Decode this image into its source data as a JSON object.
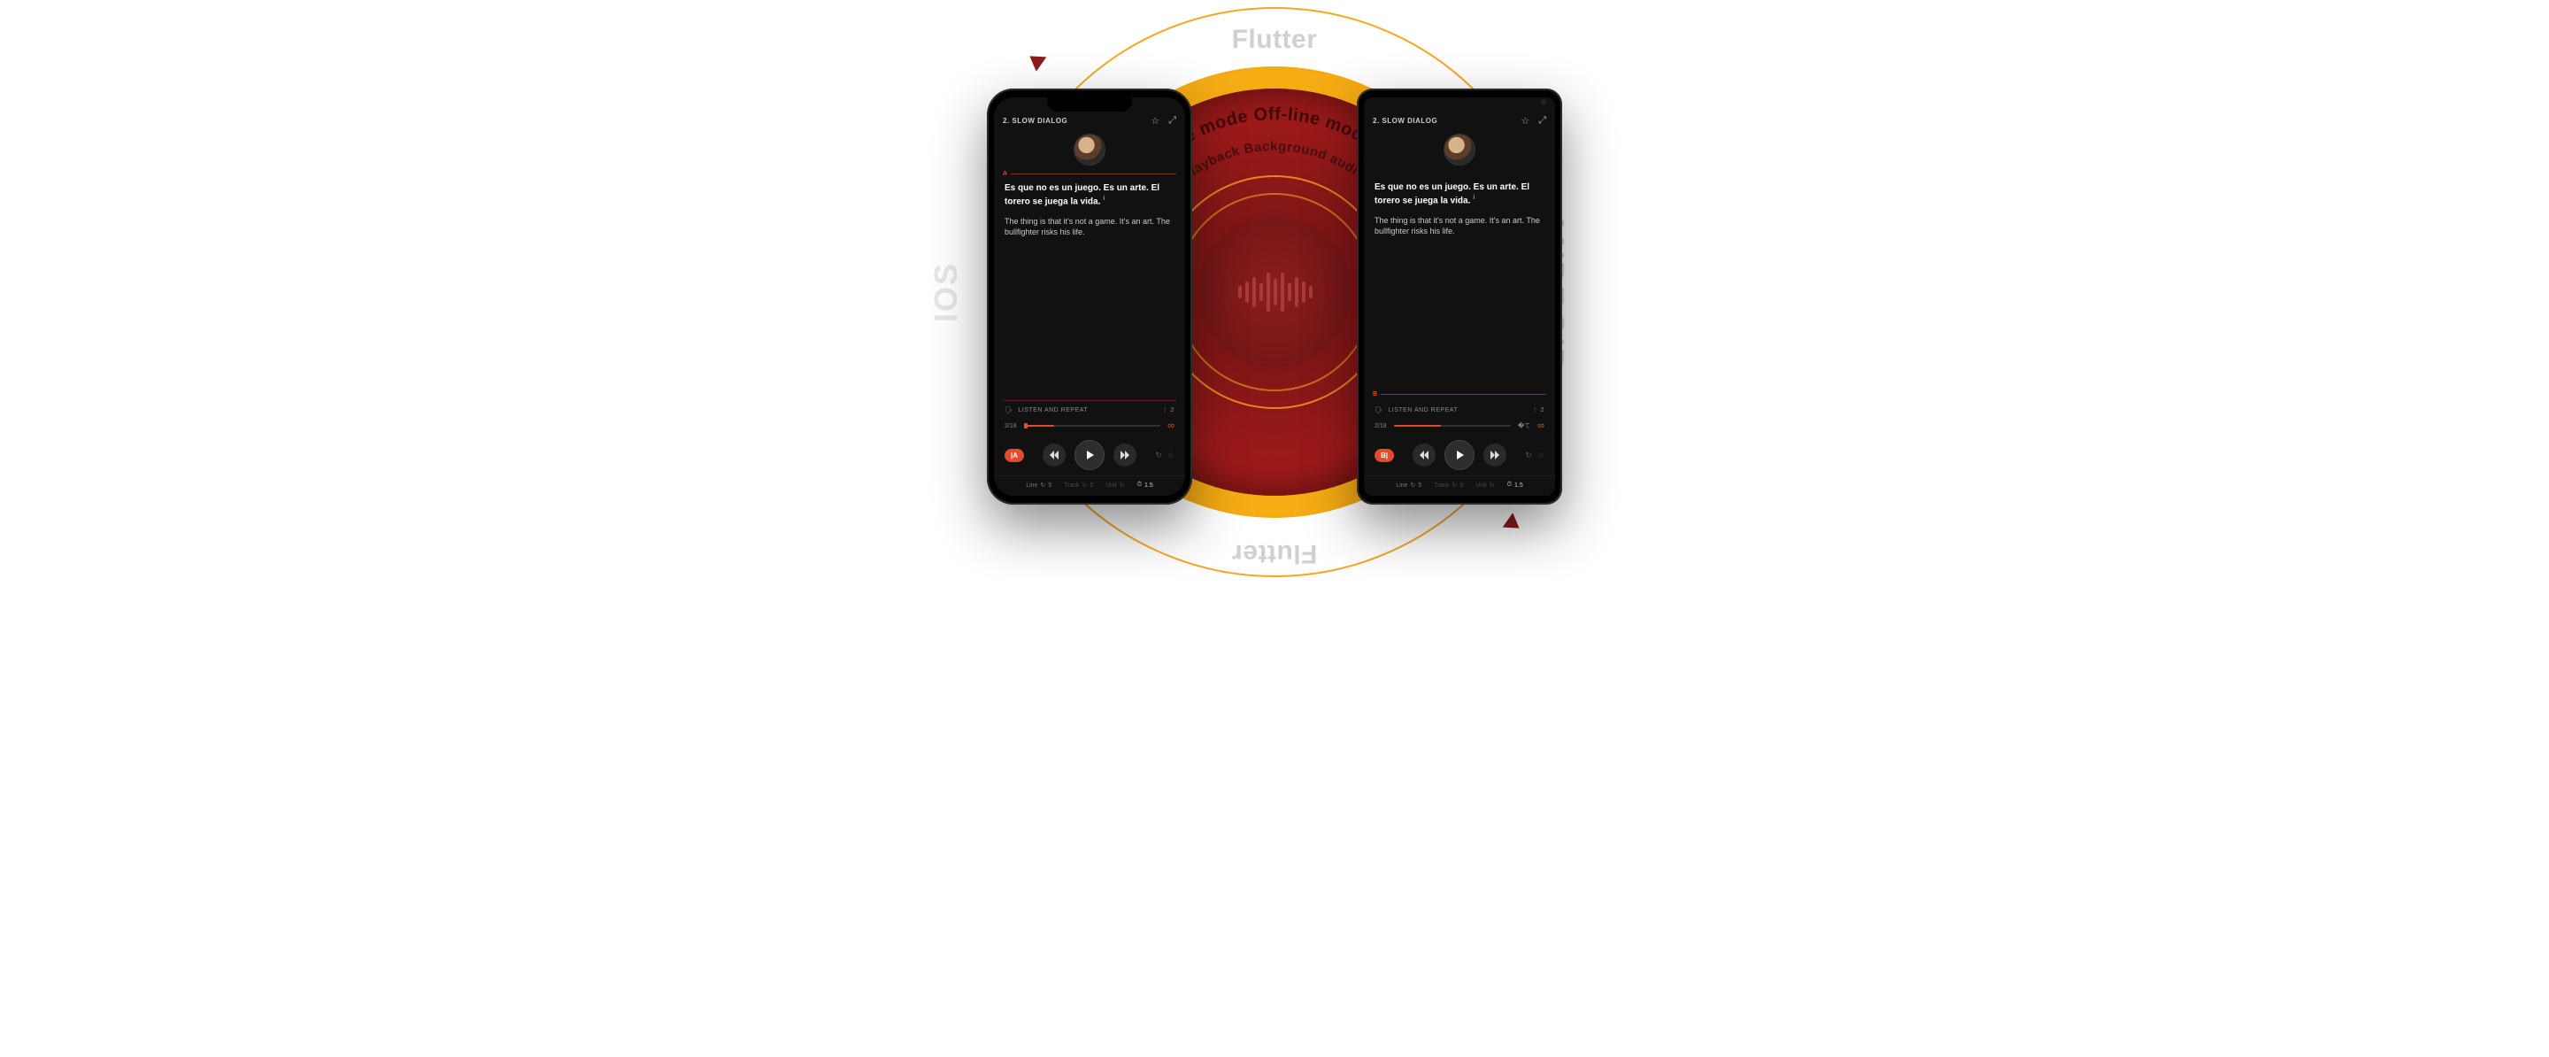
{
  "diagram": {
    "flutter_label": "Flutter",
    "ios_label": "IOS",
    "android_label": "ANDROID",
    "ring_outer_text": "Off-line mode  Off-line mode  Off-line mode  Off-line mode",
    "ring_inner_text": "Background audio playback  Background audio playback"
  },
  "phone_ios": {
    "title": "2. SLOW DIALOG",
    "marker": "A",
    "source_text": "Es que no es un juego. Es un arte. El torero se juega la vida.",
    "footnote": "i",
    "translation": "The thing is that it's not a game. It's an art. The bullfighter risks his life.",
    "listen_label": "LISTEN AND REPEAT",
    "listen_count": "2",
    "progress_label": "2/18",
    "pill": "|A",
    "line_label": "Line",
    "line_value": "5",
    "track_label": "Track",
    "track_value": "5",
    "unit_label": "Unit",
    "speed": "1.5"
  },
  "phone_android": {
    "title": "2. SLOW DIALOG",
    "marker": "B",
    "source_text": "Es que no es un juego. Es un arte. El torero se juega la vida.",
    "footnote": "i",
    "translation": "The thing is that it's not a game. It's an art. The bullfighter risks his life.",
    "listen_label": "LISTEN AND REPEAT",
    "listen_count": "2",
    "progress_label": "2/18",
    "pill": "B|",
    "line_label": "Line",
    "line_value": "5",
    "track_label": "Track",
    "track_value": "5",
    "unit_label": "Unit",
    "speed": "1.5"
  }
}
